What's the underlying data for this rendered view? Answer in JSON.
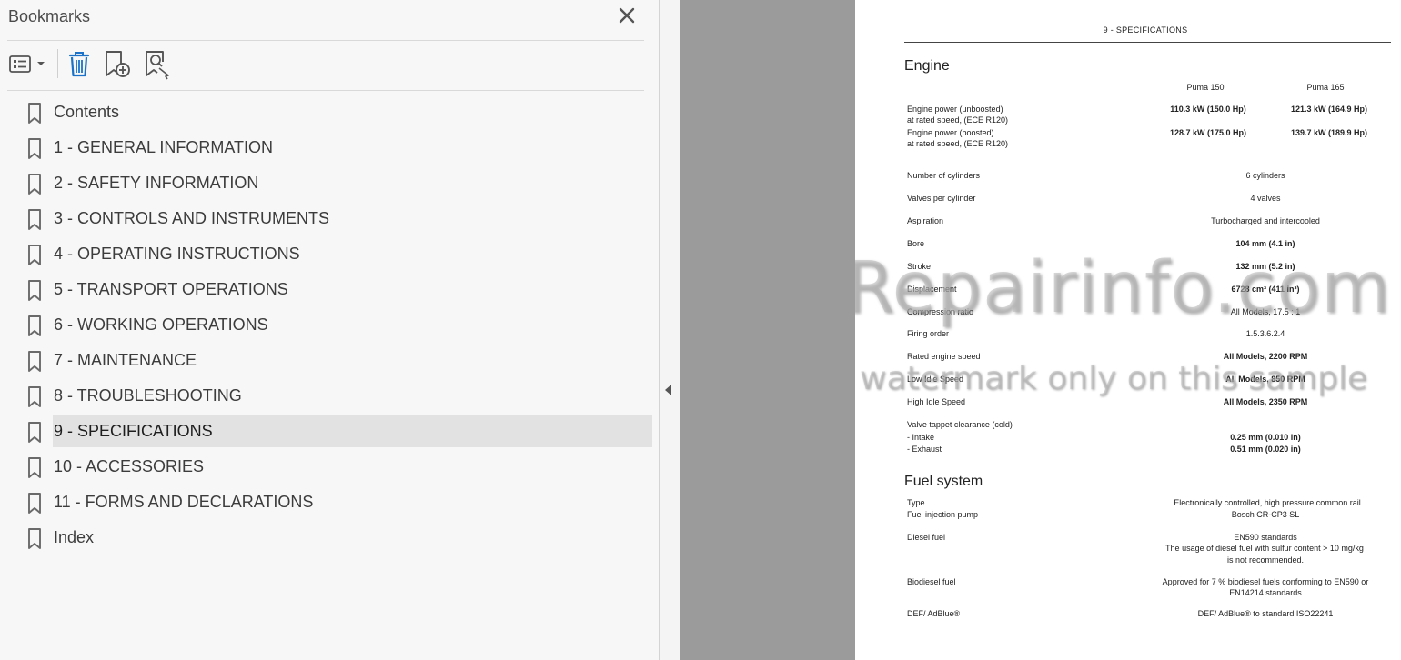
{
  "panel": {
    "title": "Bookmarks",
    "toolbar": {
      "options_icon": "list-options-icon",
      "delete_icon": "trash-icon",
      "new_bookmark_icon": "bookmark-add-icon",
      "find_bookmark_icon": "bookmark-find-icon"
    },
    "items": [
      {
        "label": "Contents",
        "selected": false
      },
      {
        "label": "1 - GENERAL INFORMATION",
        "selected": false
      },
      {
        "label": "2 - SAFETY INFORMATION",
        "selected": false
      },
      {
        "label": "3 - CONTROLS AND INSTRUMENTS",
        "selected": false
      },
      {
        "label": "4 - OPERATING INSTRUCTIONS",
        "selected": false
      },
      {
        "label": "5 - TRANSPORT OPERATIONS",
        "selected": false
      },
      {
        "label": "6 - WORKING OPERATIONS",
        "selected": false
      },
      {
        "label": "7 - MAINTENANCE",
        "selected": false
      },
      {
        "label": "8 - TROUBLESHOOTING",
        "selected": false
      },
      {
        "label": "9 - SPECIFICATIONS",
        "selected": true
      },
      {
        "label": "10 - ACCESSORIES",
        "selected": false
      },
      {
        "label": "11 - FORMS AND DECLARATIONS",
        "selected": false
      },
      {
        "label": "Index",
        "selected": false
      }
    ]
  },
  "colors": {
    "panel_bg": "#f7f7f7",
    "selected_bg": "#e2e2e2",
    "gutter_gray": "#9b9b9b",
    "page_bg": "#ffffff"
  },
  "document": {
    "header": "9 - SPECIFICATIONS",
    "engine": {
      "title": "Engine",
      "col1": "Puma 150",
      "col2": "Puma 165",
      "power_unboosted_l1": "Engine power (unboosted)",
      "power_unboosted_l2": "at rated speed, (ECE R120)",
      "power_unboosted_v1": "110.3 kW (150.0 Hp)",
      "power_unboosted_v2": "121.3 kW (164.9 Hp)",
      "power_boosted_l1": "Engine power (boosted)",
      "power_boosted_l2": "at rated speed, (ECE R120)",
      "power_boosted_v1": "128.7 kW (175.0 Hp)",
      "power_boosted_v2": "139.7 kW (189.9 Hp)",
      "rows": [
        {
          "label": "Number of cylinders",
          "value": "6 cylinders",
          "bold": false
        },
        {
          "label": "Valves per cylinder",
          "value": "4 valves",
          "bold": false
        },
        {
          "label": "Aspiration",
          "value": "Turbocharged and intercooled",
          "bold": false
        },
        {
          "label": "Bore",
          "value": "104 mm (4.1 in)",
          "bold": true
        },
        {
          "label": "Stroke",
          "value": "132 mm (5.2 in)",
          "bold": true
        },
        {
          "label": "Displacement",
          "value": "6728 cm³ (411 in³)",
          "bold": true
        },
        {
          "label": "Compression ratio",
          "value": "All Models, 17.5 : 1",
          "bold": false
        },
        {
          "label": "Firing order",
          "value": "1.5.3.6.2.4",
          "bold": false
        },
        {
          "label": "Rated engine speed",
          "value": "All Models, 2200 RPM",
          "bold": true
        },
        {
          "label": "Low Idle Speed",
          "value": "All Models, 850 RPM",
          "bold": true
        },
        {
          "label": "High Idle Speed",
          "value": "All Models, 2350 RPM",
          "bold": true
        }
      ],
      "valve_label": "Valve tappet clearance (cold)",
      "intake_label": "- Intake",
      "intake_value": "0.25 mm (0.010 in)",
      "exhaust_label": "- Exhaust",
      "exhaust_value": "0.51 mm (0.020 in)"
    },
    "fuel": {
      "title": "Fuel system",
      "type_label": "Type",
      "type_value": "Electronically controlled, high pressure common rail",
      "pump_label": "Fuel injection pump",
      "pump_value": "Bosch CR-CP3 SL",
      "diesel_label": "Diesel fuel",
      "diesel_v1": "EN590 standards",
      "diesel_v2": "The usage of diesel fuel with sulfur content > 10 mg/kg",
      "diesel_v3": "is not recommended.",
      "bio_label": "Biodiesel fuel",
      "bio_v1": "Approved for 7 % biodiesel fuels conforming to EN590 or",
      "bio_v2": "EN14214 standards",
      "def_label": "DEF/ AdBlue®",
      "def_value": "DEF/ AdBlue® to standard ISO22241"
    },
    "watermark_1": "eRepairinfo.com",
    "watermark_2": "watermark only on this sample"
  }
}
